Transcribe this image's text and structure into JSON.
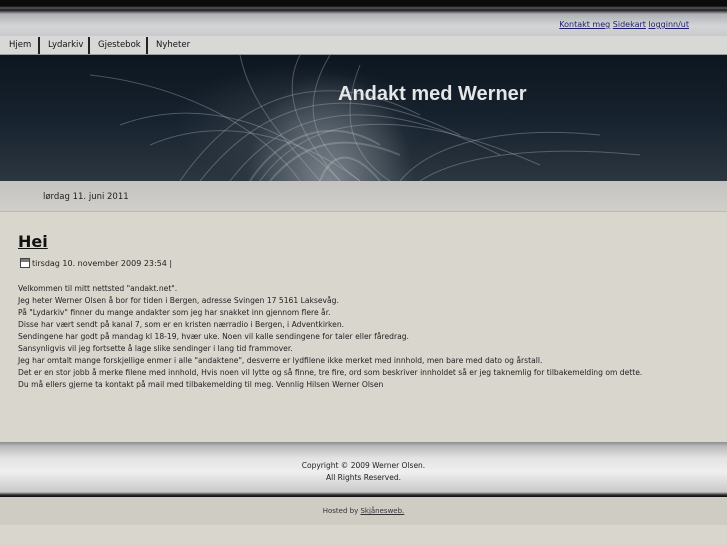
{
  "header": {
    "links": [
      {
        "label": "Kontakt meg"
      },
      {
        "label": "Sidekart"
      },
      {
        "label": "logginn/ut"
      }
    ]
  },
  "nav": {
    "items": [
      {
        "label": "Hjem"
      },
      {
        "label": "Lydarkiv"
      },
      {
        "label": "Gjestebok"
      },
      {
        "label": "Nyheter"
      }
    ]
  },
  "banner": {
    "title": "Andakt med Werner"
  },
  "date_bar": {
    "text": "lørdag 11. juni 2011"
  },
  "post": {
    "title": "Hei",
    "meta": "tirsdag 10. november 2009 23:54 |",
    "icon": "calendar-icon",
    "lines": [
      "Velkommen til mitt nettsted \"andakt.net\".",
      "Jeg heter Werner Olsen å bor for tiden i Bergen, adresse Svingen 17 5161 Laksevåg.",
      "På \"Lydarkiv\" finner du mange andakter som jeg har snakket inn gjennom flere år.",
      "Disse har vært sendt på kanal 7, som er en kristen nærradio i Bergen, i Adventkirken.",
      "Sendingene har godt på mandag kl 18-19, hvær uke. Noen vil kalle sendingene for taler eller fåredrag.",
      "Sansynligvis vil jeg fortsette å lage slike sendinger i lang tid frammover.",
      "Jeg har omtalt mange forskjellige enmer i alle \"andaktene\", desverre er lydfilene ikke merket med innhold, men bare med dato og årstall.",
      "Det er en stor jobb å merke filene med innhold, Hvis noen vil lytte og så finne, tre fire, ord som beskriver innholdet så er jeg taknemlig for tilbakemelding om dette.",
      "Du må ellers gjerne ta kontakt på mail med tilbakemelding til meg.  Vennlig Hilsen Werner Olsen"
    ]
  },
  "footer": {
    "copyright": "Copyright © 2009 Werner Olsen.",
    "rights": "All Rights Reserved.",
    "hosted_prefix": "Hosted by ",
    "hosted_link": "Skjånesweb."
  }
}
